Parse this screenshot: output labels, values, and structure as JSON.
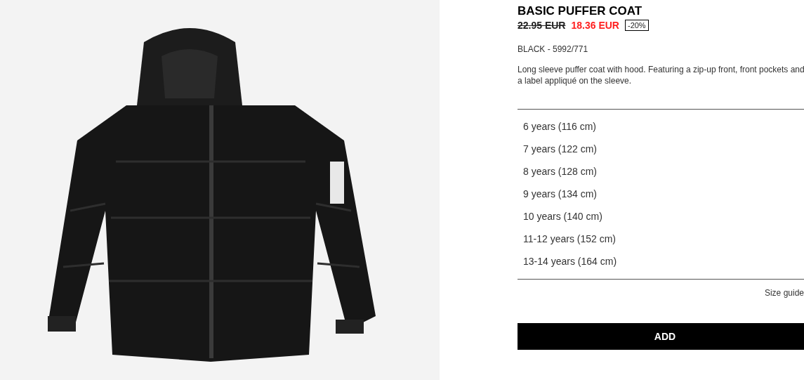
{
  "product": {
    "name": "BASIC PUFFER COAT",
    "old_price": "22.95 EUR",
    "price": "18.36 EUR",
    "discount": "-20%",
    "color_ref": "BLACK - 5992/771",
    "description": "Long sleeve puffer coat with hood. Featuring a zip-up front, front pockets and a label appliqué on the sleeve."
  },
  "sizes": [
    {
      "label": "6 years (116 cm)"
    },
    {
      "label": "7 years (122 cm)"
    },
    {
      "label": "8 years (128 cm)"
    },
    {
      "label": "9 years (134 cm)"
    },
    {
      "label": "10 years (140 cm)"
    },
    {
      "label": "11-12 years (152 cm)"
    },
    {
      "label": "13-14 years (164 cm)"
    }
  ],
  "size_guide": "Size guide",
  "add_button": "ADD"
}
